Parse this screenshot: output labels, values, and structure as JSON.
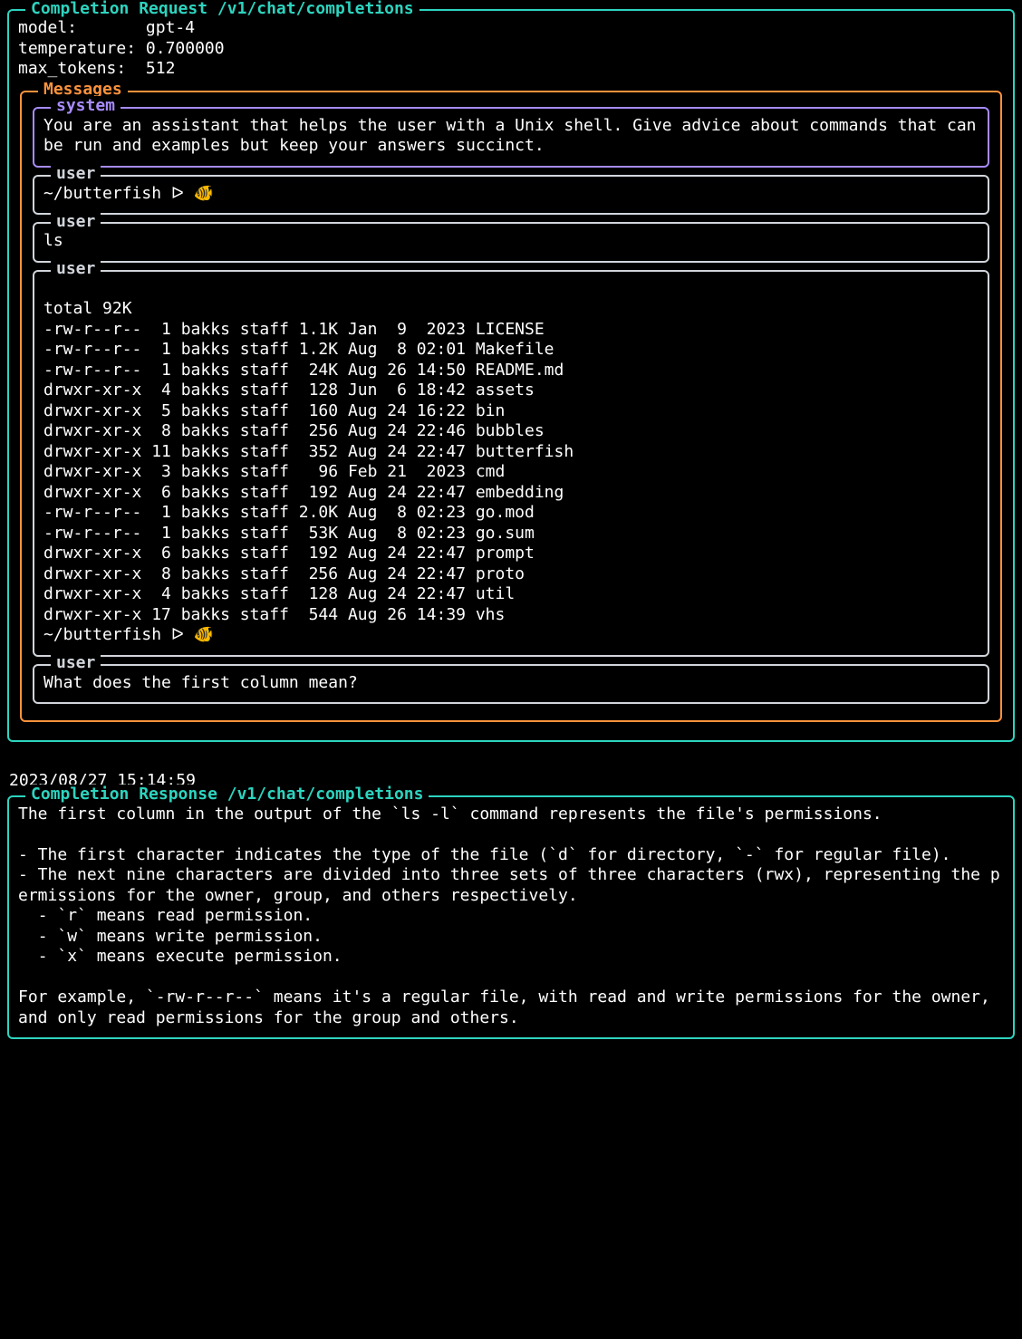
{
  "request": {
    "title": "Completion Request /v1/chat/completions",
    "params": {
      "model_label": "model:",
      "model_value": "gpt-4",
      "temperature_label": "temperature:",
      "temperature_value": "0.700000",
      "max_tokens_label": "max_tokens:",
      "max_tokens_value": "512"
    },
    "messages_title": "Messages",
    "messages": [
      {
        "role": "system",
        "content": "You are an assistant that helps the user with a Unix shell. Give advice about commands that can be run and examples but keep your answers succinct."
      },
      {
        "role": "user",
        "content": "~/butterfish ᐅ 🐠"
      },
      {
        "role": "user",
        "content": "ls"
      },
      {
        "role": "user",
        "content": "\ntotal 92K\n-rw-r--r--  1 bakks staff 1.1K Jan  9  2023 LICENSE\n-rw-r--r--  1 bakks staff 1.2K Aug  8 02:01 Makefile\n-rw-r--r--  1 bakks staff  24K Aug 26 14:50 README.md\ndrwxr-xr-x  4 bakks staff  128 Jun  6 18:42 assets\ndrwxr-xr-x  5 bakks staff  160 Aug 24 16:22 bin\ndrwxr-xr-x  8 bakks staff  256 Aug 24 22:46 bubbles\ndrwxr-xr-x 11 bakks staff  352 Aug 24 22:47 butterfish\ndrwxr-xr-x  3 bakks staff   96 Feb 21  2023 cmd\ndrwxr-xr-x  6 bakks staff  192 Aug 24 22:47 embedding\n-rw-r--r--  1 bakks staff 2.0K Aug  8 02:23 go.mod\n-rw-r--r--  1 bakks staff  53K Aug  8 02:23 go.sum\ndrwxr-xr-x  6 bakks staff  192 Aug 24 22:47 prompt\ndrwxr-xr-x  8 bakks staff  256 Aug 24 22:47 proto\ndrwxr-xr-x  4 bakks staff  128 Aug 24 22:47 util\ndrwxr-xr-x 17 bakks staff  544 Aug 26 14:39 vhs\n~/butterfish ᐅ 🐠"
      },
      {
        "role": "user",
        "content": "What does the first column mean?"
      }
    ]
  },
  "timestamp": "2023/08/27 15:14:59",
  "response": {
    "title": "Completion Response /v1/chat/completions",
    "content": "The first column in the output of the `ls -l` command represents the file's permissions.\n\n- The first character indicates the type of the file (`d` for directory, `-` for regular file).\n- The next nine characters are divided into three sets of three characters (rwx), representing the permissions for the owner, group, and others respectively.\n  - `r` means read permission.\n  - `w` means write permission.\n  - `x` means execute permission.\n\nFor example, `-rw-r--r--` means it's a regular file, with read and write permissions for the owner, and only read permissions for the group and others."
  }
}
